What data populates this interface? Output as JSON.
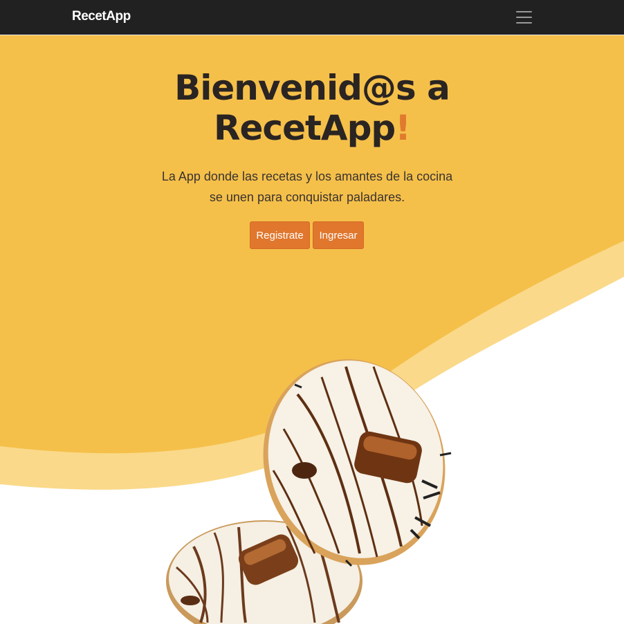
{
  "navbar": {
    "brand": "RecetApp",
    "menu_icon": "hamburger-menu-icon"
  },
  "hero": {
    "title_line1": "Bienvenid@s a",
    "title_line2": "RecetApp",
    "title_accent": "!",
    "subtitle": "La App donde las recetas y los amantes de la cocina se unen para conquistar paladares.",
    "register_label": "Registrate",
    "login_label": "Ingresar"
  },
  "colors": {
    "navbar": "#212121",
    "hero_yellow": "#f5c04a",
    "wave_light": "#fad98a",
    "accent_orange": "#e0772d"
  },
  "image": {
    "subject": "donuts-chocolate-image"
  }
}
